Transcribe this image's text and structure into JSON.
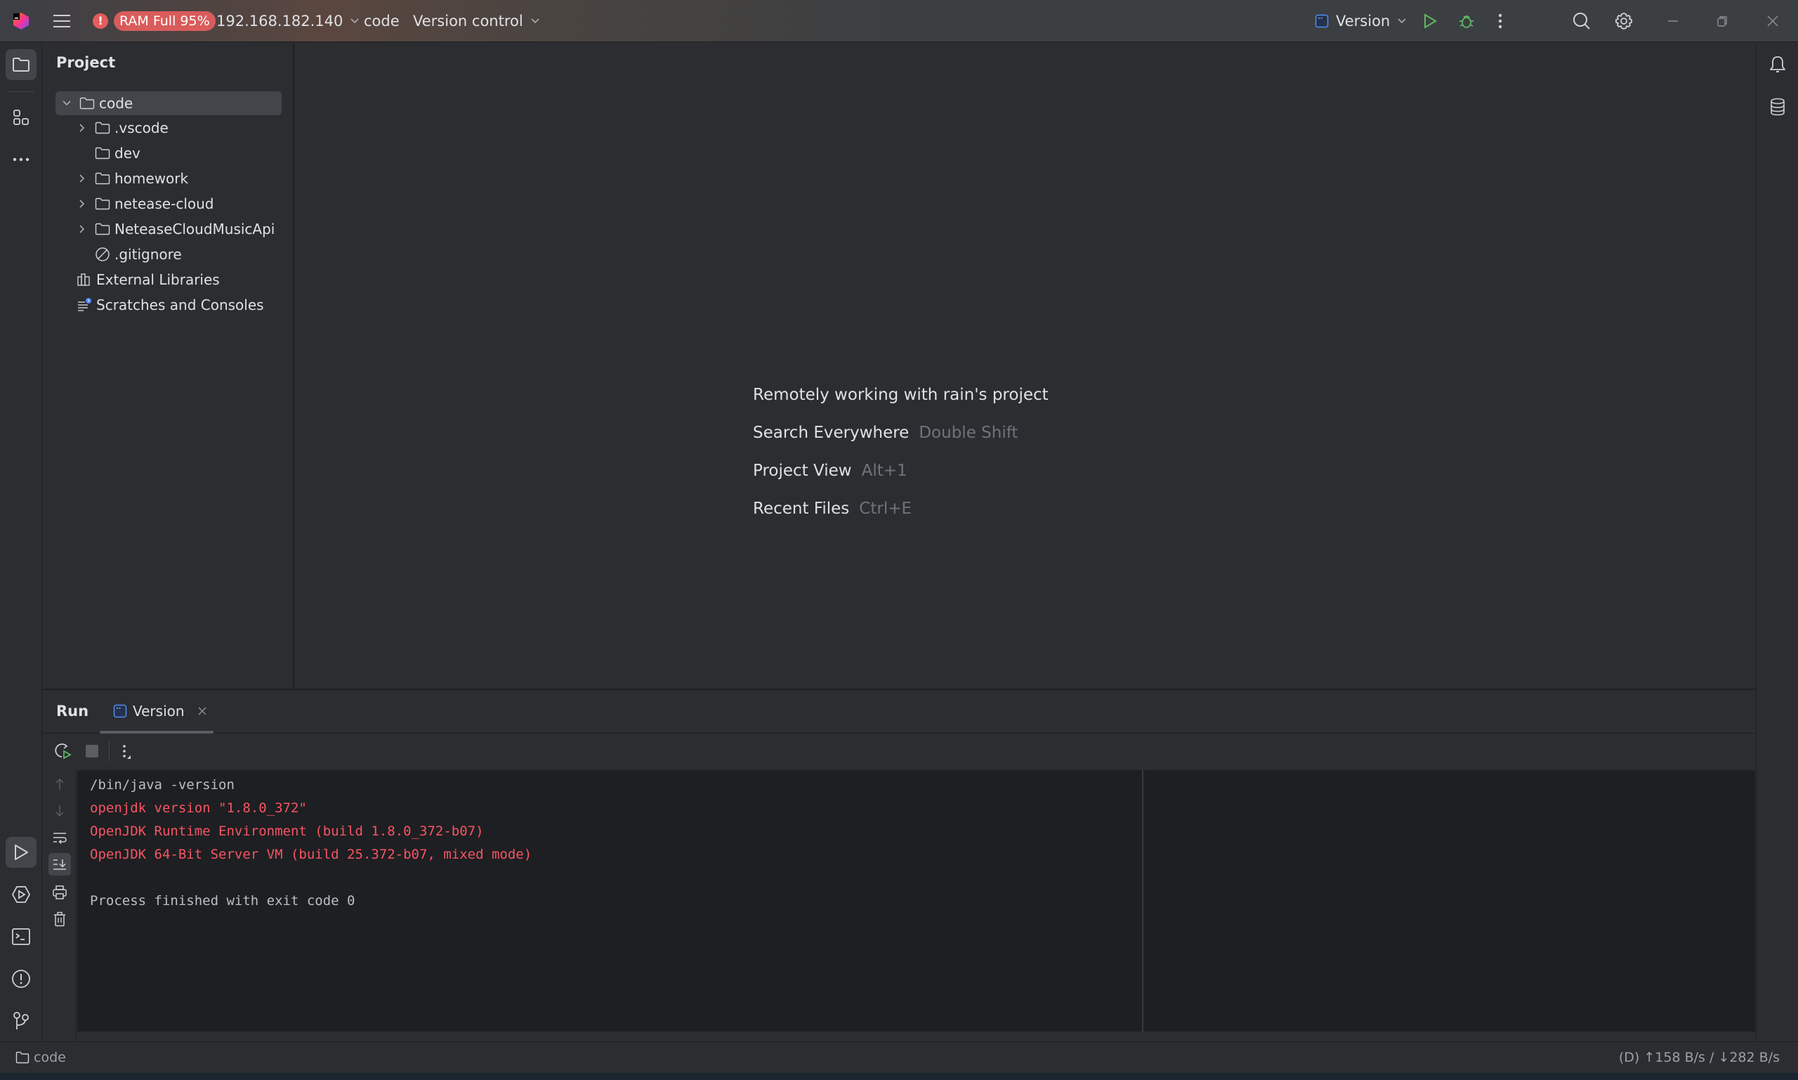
{
  "titlebar": {
    "menu_icon": "hamburger-menu-icon",
    "warning_icon": "error-icon",
    "ram_badge": "RAM Full 95%",
    "host": "192.168.182.140",
    "project": "code",
    "vcs": "Version control",
    "run_config": "Version",
    "window_controls": [
      "minimize",
      "restore",
      "close"
    ]
  },
  "left_strip": {
    "top": [
      "project-folder-icon",
      "structure-icon",
      "more-icon"
    ],
    "bottom": [
      "run-icon",
      "services-icon",
      "terminal-icon",
      "problems-icon",
      "git-icon"
    ]
  },
  "right_strip": [
    "notifications-bell-icon",
    "database-icon"
  ],
  "project_panel": {
    "title": "Project",
    "tree": [
      {
        "label": "code",
        "type": "folder",
        "expanded": true,
        "selected": true,
        "depth": 0
      },
      {
        "label": ".vscode",
        "type": "folder",
        "expandable": true,
        "depth": 1
      },
      {
        "label": "dev",
        "type": "folder",
        "expandable": false,
        "depth": 1
      },
      {
        "label": "homework",
        "type": "folder",
        "expandable": true,
        "depth": 1
      },
      {
        "label": "netease-cloud",
        "type": "folder",
        "expandable": true,
        "depth": 1
      },
      {
        "label": "NeteaseCloudMusicApi",
        "type": "folder",
        "expandable": true,
        "depth": 1
      },
      {
        "label": ".gitignore",
        "type": "ignored-file",
        "depth": 1
      },
      {
        "label": "External Libraries",
        "type": "libraries",
        "depth": 0
      },
      {
        "label": "Scratches and Consoles",
        "type": "scratches",
        "depth": 0
      }
    ]
  },
  "editor_hints": {
    "remote": "Remotely working with rain's project",
    "items": [
      {
        "label": "Search Everywhere",
        "shortcut": "Double Shift"
      },
      {
        "label": "Project View",
        "shortcut": "Alt+1"
      },
      {
        "label": "Recent Files",
        "shortcut": "Ctrl+E"
      }
    ]
  },
  "run_panel": {
    "title": "Run",
    "tab": "Version",
    "console": [
      {
        "text": "/bin/java -version",
        "kind": "normal"
      },
      {
        "text": "openjdk version \"1.8.0_372\"",
        "kind": "err"
      },
      {
        "text": "OpenJDK Runtime Environment (build 1.8.0_372-b07)",
        "kind": "err"
      },
      {
        "text": "OpenJDK 64-Bit Server VM (build 25.372-b07, mixed mode)",
        "kind": "err"
      },
      {
        "text": "",
        "kind": "normal"
      },
      {
        "text": "Process finished with exit code 0",
        "kind": "normal"
      }
    ]
  },
  "statusbar": {
    "breadcrumb": "code",
    "network": "(D) ↑158 B/s / ↓282 B/s"
  },
  "colors": {
    "accent_green": "#5fb865",
    "error_red": "#f75464",
    "badge_red": "#d95c5c",
    "tab_blue": "#548af7"
  }
}
